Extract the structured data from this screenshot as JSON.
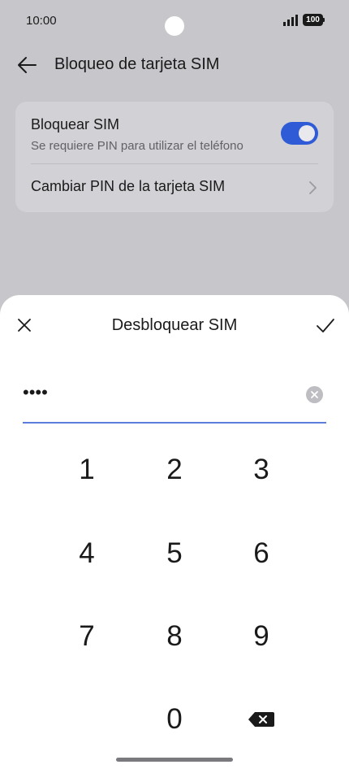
{
  "status_bar": {
    "time": "10:00",
    "battery": "100",
    "signal_icon": "signal-bars-icon",
    "battery_icon": "battery-icon"
  },
  "header": {
    "title": "Bloqueo de tarjeta SIM",
    "back_icon": "arrow-left-icon"
  },
  "settings": {
    "lock_sim": {
      "title": "Bloquear SIM",
      "subtitle": "Se requiere PIN para utilizar el teléfono",
      "enabled": true
    },
    "change_pin": {
      "label": "Cambiar PIN de la tarjeta SIM"
    }
  },
  "dialog": {
    "title": "Desbloquear SIM",
    "close_icon": "close-icon",
    "confirm_icon": "check-icon",
    "pin_masked": "••••",
    "clear_icon": "clear-circle-icon"
  },
  "keypad": {
    "keys": [
      "1",
      "2",
      "3",
      "4",
      "5",
      "6",
      "7",
      "8",
      "9",
      "0"
    ],
    "backspace_icon": "backspace-icon"
  },
  "colors": {
    "accent": "#2f5bd6",
    "background": "#c7c7cb",
    "sheet": "#ffffff"
  }
}
